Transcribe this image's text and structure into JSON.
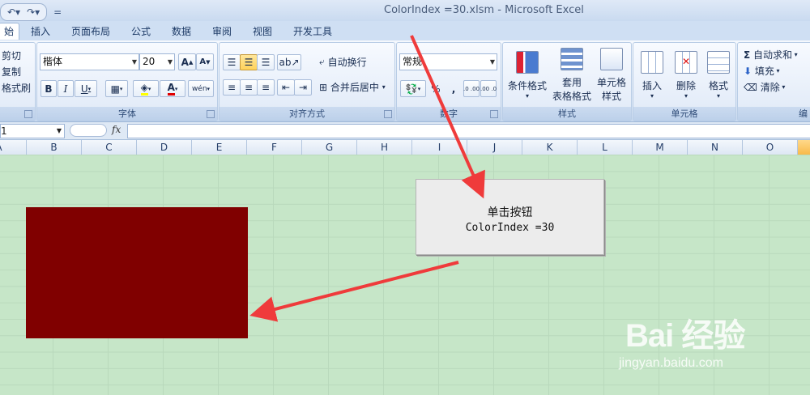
{
  "window": {
    "title": "ColorIndex =30.xlsm - Microsoft Excel"
  },
  "qat": {
    "undo_icon": "undo-icon",
    "redo_icon": "redo-icon",
    "customize_icon": "customize-icon"
  },
  "tabs": [
    {
      "label": "始",
      "active": true
    },
    {
      "label": "插入"
    },
    {
      "label": "页面布局"
    },
    {
      "label": "公式"
    },
    {
      "label": "数据"
    },
    {
      "label": "审阅"
    },
    {
      "label": "视图"
    },
    {
      "label": "开发工具"
    }
  ],
  "clipboard": {
    "cut": "剪切",
    "copy": "复制",
    "format_painter": "格式刷"
  },
  "font": {
    "name": "楷体",
    "size": "20",
    "grow": "A",
    "shrink": "A",
    "bold": "B",
    "italic": "I",
    "underline": "U",
    "font_color": "A",
    "phonetic": "wén",
    "group_label": "字体"
  },
  "alignment": {
    "wrap_text": "自动换行",
    "merge_center": "合并后居中",
    "group_label": "对齐方式"
  },
  "number": {
    "format": "常规",
    "percent": "%",
    "comma": ",",
    "inc_decimal": ".0 .00",
    "dec_decimal": ".00 .0",
    "group_label": "数字"
  },
  "styles": {
    "conditional": "条件格式",
    "table_format_1": "套用",
    "table_format_2": "表格格式",
    "cell_styles_1": "单元格",
    "cell_styles_2": "样式",
    "group_label": "样式"
  },
  "cells": {
    "insert": "插入",
    "delete": "删除",
    "format": "格式",
    "group_label": "单元格"
  },
  "editing": {
    "autosum": "自动求和",
    "fill": "填充",
    "clear": "清除",
    "group_label": "编"
  },
  "formula_bar": {
    "name_box": "1",
    "fx": "fx"
  },
  "columns": [
    "A",
    "B",
    "C",
    "D",
    "E",
    "F",
    "G",
    "H",
    "I",
    "J",
    "K",
    "L",
    "M",
    "N",
    "O"
  ],
  "sheet": {
    "macro_button": {
      "line1": "单击按钮",
      "line2": "ColorIndex =30"
    },
    "filled_color": "#800000",
    "arrow_color": "#ef3b3b"
  },
  "watermark": {
    "logo": "Bai 经验",
    "url": "jingyan.baidu.com"
  }
}
